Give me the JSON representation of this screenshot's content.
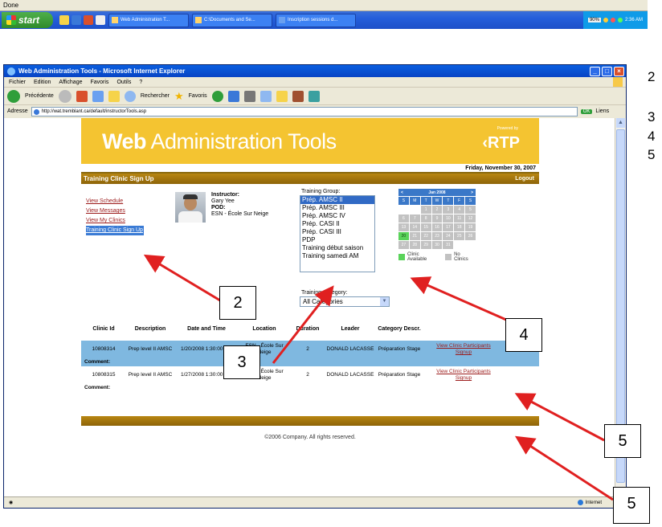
{
  "taskbar": {
    "status_text": "Done",
    "start_label": "start",
    "tasks": [
      {
        "label": "Web Administration T..."
      },
      {
        "label": "C:\\Documents and Se..."
      },
      {
        "label": "Inscription sessions d..."
      }
    ],
    "tray_battery": "90%",
    "clock": "2:36 AM"
  },
  "browser": {
    "title": "Web Administration Tools - Microsoft Internet Explorer",
    "menu": [
      "Fichier",
      "Edition",
      "Affichage",
      "Favoris",
      "Outils",
      "?"
    ],
    "toolbar": {
      "back": "Précédente",
      "search": "Rechercher",
      "favorites": "Favoris"
    },
    "address_label": "Adresse",
    "address": "http://wat.tremblant.ca/default/instructorTools.asp",
    "go": "OK",
    "links": "Liens",
    "status_zone": "Internet"
  },
  "app": {
    "brand_bold": "Web",
    "brand_rest": " Administration Tools",
    "powered": "Powered by",
    "rtp": "RTP",
    "date": "Friday, November 30, 2007",
    "section_title": "Training Clinic Sign Up",
    "logout": "Logout",
    "nav": [
      "View Schedule",
      "View Messages",
      "View My Clinics",
      "Training Clinic Sign Up"
    ],
    "instructor_label": "Instructor:",
    "instructor_name": "Gary Yee",
    "pod_label": "POD:",
    "pod_value": "ESN - École Sur Neige",
    "training_group_label": "Training Group:",
    "training_groups": [
      "Prép. AMSC II",
      "Prép. AMSC III",
      "Prép. AMSC IV",
      "Prép. CASI II",
      "Prép. CASI III",
      "PDP",
      "Training début saison",
      "Training samedi AM"
    ],
    "training_category_label": "Training Category:",
    "training_category_value": "All Categories",
    "calendar": {
      "month": "Jan 2008",
      "prev": "<",
      "next": ">",
      "dow": [
        "S",
        "M",
        "T",
        "W",
        "T",
        "F",
        "S"
      ],
      "days": [
        "",
        "",
        "1",
        "2",
        "3",
        "4",
        "5",
        "6",
        "7",
        "8",
        "9",
        "10",
        "11",
        "12",
        "13",
        "14",
        "15",
        "16",
        "17",
        "18",
        "19",
        "20",
        "21",
        "22",
        "23",
        "24",
        "25",
        "26",
        "27",
        "28",
        "29",
        "30",
        "31",
        "",
        ""
      ],
      "available_day": "20",
      "legend_available": "Clinic Available",
      "legend_none": "No Clinics",
      "color_available": "#5ad35a",
      "color_none": "#c2c2c2"
    },
    "table": {
      "headers": [
        "Clinic Id",
        "Description",
        "Date and Time",
        "Location",
        "Duration",
        "Leader",
        "Category Descr.",
        ""
      ],
      "rows": [
        {
          "id": "10808314",
          "description": "Prep level II AMSC",
          "date": "1/20/2008 1:30:00 PM",
          "location": "ESN - École Sur Neige",
          "duration": "2",
          "leader": "DONALD LACASSE",
          "category": "Préparation Stage",
          "link1": "View Clinic Participants",
          "link2": "Signup"
        },
        {
          "id": "10808315",
          "description": "Prep level II AMSC",
          "date": "1/27/2008 1:30:00 PM",
          "location": "ESN - École Sur Neige",
          "duration": "2",
          "leader": "DONALD LACASSE",
          "category": "Préparation Stage",
          "link1": "View Clinic Participants",
          "link2": "Signup"
        }
      ],
      "comment_label": "Comment:"
    },
    "copyright": "©2006 Company. All rights reserved."
  },
  "annotations": {
    "callouts": [
      "2",
      "3",
      "4",
      "5",
      "5"
    ],
    "side_numbers": [
      "2",
      "3",
      "4",
      "5"
    ]
  }
}
